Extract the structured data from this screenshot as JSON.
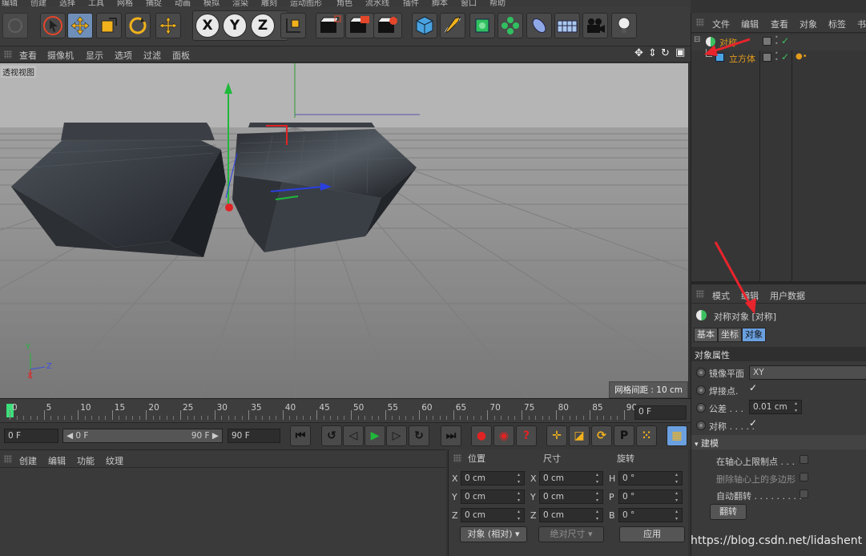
{
  "menubar": [
    "编辑",
    "创建",
    "选择",
    "工具",
    "网格",
    "捕捉",
    "动画",
    "模拟",
    "渲染",
    "雕刻",
    "运动图形",
    "角色",
    "流水线",
    "插件",
    "脚本",
    "窗口",
    "帮助"
  ],
  "toolbar": {
    "x_label": "X",
    "y_label": "Y",
    "z_label": "Z",
    "p_label": "P"
  },
  "viewport_menu": [
    "查看",
    "摄像机",
    "显示",
    "选项",
    "过滤",
    "面板"
  ],
  "viewport": {
    "label": "透视视图",
    "grid_info": "网格间距 : 10 cm",
    "axis_y": "Y",
    "axis_z": "Z",
    "axis_x": "X"
  },
  "timeline": {
    "ticks": [
      "0",
      "5",
      "10",
      "15",
      "20",
      "25",
      "30",
      "35",
      "40",
      "45",
      "50",
      "55",
      "60",
      "65",
      "70",
      "75",
      "80",
      "85",
      "90"
    ],
    "current_frame": "0 F"
  },
  "transport": {
    "start_field": "0 F",
    "range_start": "◀ 0 F",
    "range_end": "90 F ▶",
    "end_field": "90 F"
  },
  "material_menu": [
    "创建",
    "编辑",
    "功能",
    "纹理"
  ],
  "coord": {
    "headers": [
      "位置",
      "尺寸",
      "旋转"
    ],
    "rows": [
      {
        "axis": "X",
        "pos": "0 cm",
        "size_axis": "X",
        "size": "0 cm",
        "rot_axis": "H",
        "rot": "0 °"
      },
      {
        "axis": "Y",
        "pos": "0 cm",
        "size_axis": "Y",
        "size": "0 cm",
        "rot_axis": "P",
        "rot": "0 °"
      },
      {
        "axis": "Z",
        "pos": "0 cm",
        "size_axis": "Z",
        "size": "0 cm",
        "rot_axis": "B",
        "rot": "0 °"
      }
    ],
    "mode": "对象 (相对)",
    "size_mode": "绝对尺寸",
    "apply": "应用"
  },
  "object_manager": {
    "menu": [
      "文件",
      "编辑",
      "查看",
      "对象",
      "标签",
      "书"
    ],
    "objects": [
      {
        "name": "对称"
      },
      {
        "name": "立方体"
      }
    ]
  },
  "attributes": {
    "menu": [
      "模式",
      "编辑",
      "用户数据"
    ],
    "object_title": "对称对象 [对称]",
    "tabs": [
      "基本",
      "坐标",
      "对象"
    ],
    "section": "对象属性",
    "mirror_plane_label": "镜像平面",
    "mirror_plane_value": "XY",
    "weld_label": "焊接点.",
    "tolerance_label": "公差 . . .",
    "tolerance_value": "0.01 cm",
    "symmetry_label": "对称 . . . . .",
    "modeling_section": "建模",
    "limit_label": "在轴心上限制点 . . .",
    "delete_label": "删除轴心上的多边形",
    "autoflip_label": "自动翻转 . . . . . . . . .",
    "flip_button": "翻转"
  },
  "watermark": "https://blog.csdn.net/lidashent",
  "colors": {
    "accent": "#6aa0e0",
    "object_name": "#e39b1b",
    "arrow": "#e8242c"
  }
}
